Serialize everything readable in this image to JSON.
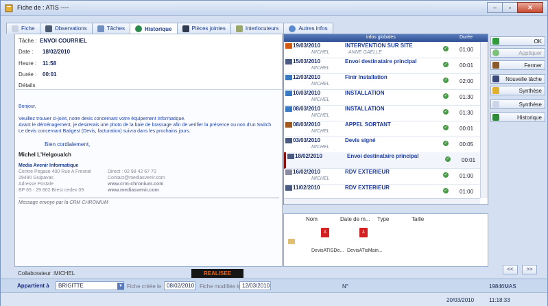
{
  "window": {
    "title": "Fiche de : ATIS ----"
  },
  "tabs": [
    {
      "label": "Fiche"
    },
    {
      "label": "Observations"
    },
    {
      "label": "Tâches"
    },
    {
      "label": "Historique"
    },
    {
      "label": "Pièces jointes"
    },
    {
      "label": "Interlocuteurs"
    },
    {
      "label": "Autres infos"
    }
  ],
  "detail": {
    "task_label": "Tâche :",
    "task": "ENVOI COURRIEL",
    "date_label": "Date :",
    "date": "18/02/2010",
    "heure_label": "Heure :",
    "heure": "11:58",
    "duree_label": "Durée :",
    "duree": "00:01",
    "details_label": "Détails"
  },
  "message": {
    "greeting": "Bonjour,",
    "p1": "Veuillez trouver ci-joint, notre devis concernant votre équipement informatique.",
    "p2": "Avant le déménagement, je desirerais une photo de la baie de brassage afin de verifier la présence ou non d'un Switch",
    "p3": "Le devis concernant Batigest (Devis, facturation) suivra dans les prochains jours.",
    "closing": "Bien cordialement,",
    "signature": "Michel L'Helgoualch",
    "company": "Media Avenir Informatique",
    "addr1": "Centre Pegase 400 Rue A Fresnel",
    "addr2": "29490 Guipavas",
    "addr3": "Adresse Postale",
    "addr4": "BP 65 - 29 802 Brest cedex 09",
    "direct": "Direct : 02 98 42 67 70",
    "contact": "Contact@mediasvenir.com",
    "web1": "www.crm-chronium.com",
    "web2": "www.mediasvenir.com",
    "footer": "Message envoye par la CRM CHRONIUM"
  },
  "collaborateur": {
    "label": "Collaborateur :",
    "name": "MICHEL"
  },
  "status_badge": "REALISEE",
  "history": {
    "header": "infos globales",
    "duree_header": "Durée",
    "rows": [
      {
        "date": "19/03/2010",
        "title": "INTERVENTION SUR SITE",
        "user": "MICHEL",
        "user2": "ANNE GAELLE",
        "dur": "01:00"
      },
      {
        "date": "15/03/2010",
        "title": "Envoi destinataire principal",
        "user": "MICHEL",
        "user2": "",
        "dur": "00:01"
      },
      {
        "date": "12/03/2010",
        "title": "Finir Installation",
        "user": "MICHEL",
        "user2": "",
        "dur": "02:00"
      },
      {
        "date": "10/03/2010",
        "title": "INSTALLATION",
        "user": "MICHEL",
        "user2": "",
        "dur": "01:30"
      },
      {
        "date": "08/03/2010",
        "title": "INSTALLATION",
        "user": "MICHEL",
        "user2": "",
        "dur": "01:30"
      },
      {
        "date": "08/03/2010",
        "title": "APPEL SORTANT",
        "user": "MICHEL",
        "user2": "",
        "dur": "00:01"
      },
      {
        "date": "03/03/2010",
        "title": "Devis signé",
        "user": "MICHEL",
        "user2": "",
        "dur": "00:05"
      },
      {
        "date": "18/02/2010",
        "title": "Envoi destinataire principal",
        "user": "",
        "user2": "",
        "dur": "00:01"
      },
      {
        "date": "16/02/2010",
        "title": "RDV EXTERIEUR",
        "user": "MICHEL",
        "user2": "",
        "dur": "01:00"
      },
      {
        "date": "11/02/2010",
        "title": "RDV EXTERIEUR",
        "user": "",
        "user2": "",
        "dur": "01:00"
      }
    ]
  },
  "files": {
    "col_nom": "Nom",
    "col_date": "Date de m...",
    "col_type": "Type",
    "col_taille": "Taille",
    "items": [
      {
        "name": "DevisATISDe..."
      },
      {
        "name": "DevisATisMain..."
      }
    ]
  },
  "buttons": {
    "ok": "OK",
    "appliquer": "Appliquer",
    "fermer": "Fermer",
    "nouvelle": "Nouvelle tâche",
    "synthese1": "Synthèse",
    "synthese2": "Synthèse",
    "historique": "Historique",
    "prev": "<<",
    "next": ">>"
  },
  "footer": {
    "appartient_label": "Appartient à",
    "appartient": "BRIGITTE",
    "creee_label": "Fiche créée le",
    "creee": "08/02/2010",
    "modifiee_label": "Fiche modifiée le",
    "modifiee": "12/03/2010",
    "num_label": "N°",
    "code": "19846MAS",
    "date": "20/03/2010",
    "time": "11:18:33"
  },
  "colors": {
    "accent": "#1f3d8c",
    "status_badge_text": "#f06010",
    "header_blue": "#2f4f95"
  }
}
